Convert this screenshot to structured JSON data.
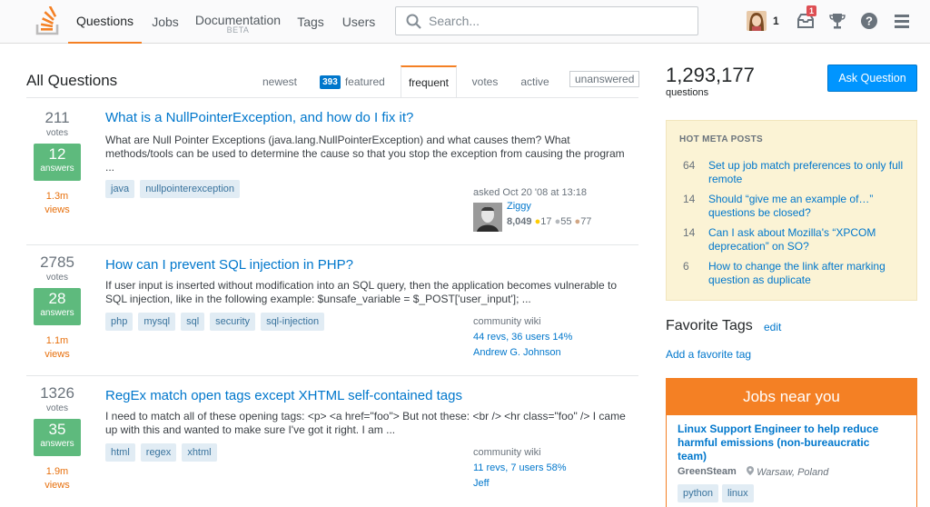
{
  "colors": {
    "accent": "#f48024",
    "link": "#0077cc",
    "accepted": "#5eba7d",
    "views_hot": "#e7700d"
  },
  "nav": {
    "items": [
      {
        "label": "Questions",
        "sub": ""
      },
      {
        "label": "Jobs",
        "sub": ""
      },
      {
        "label": "Documentation",
        "sub": "BETA"
      },
      {
        "label": "Tags",
        "sub": ""
      },
      {
        "label": "Users",
        "sub": ""
      }
    ]
  },
  "search": {
    "placeholder": "Search..."
  },
  "user": {
    "reputation": "1",
    "inbox_count": "1"
  },
  "page": {
    "title": "All Questions"
  },
  "tabs": {
    "newest": "newest",
    "featured_count": "393",
    "featured": "featured",
    "frequent": "frequent",
    "votes": "votes",
    "active": "active",
    "unanswered": "unanswered"
  },
  "questions": [
    {
      "votes": "211",
      "votes_label": "votes",
      "answers": "12",
      "answers_label": "answers",
      "views": "1.3m",
      "views_label": "views",
      "title": "What is a NullPointerException, and how do I fix it?",
      "excerpt": "What are Null Pointer Exceptions (java.lang.NullPointerException) and what causes them? What methods/tools can be used to determine the cause so that you stop the exception from causing the program ...",
      "tags": [
        "java",
        "nullpointerexception"
      ],
      "asked": "asked Oct 20 '08 at 13:18",
      "user": "Ziggy",
      "rep": "8,049",
      "gold": "17",
      "silver": "55",
      "bronze": "77"
    },
    {
      "votes": "2785",
      "votes_label": "votes",
      "answers": "28",
      "answers_label": "answers",
      "views": "1.1m",
      "views_label": "views",
      "title": "How can I prevent SQL injection in PHP?",
      "excerpt": "If user input is inserted without modification into an SQL query, then the application becomes vulnerable to SQL injection, like in the following example: $unsafe_variable = $_POST['user_input']; ...",
      "tags": [
        "php",
        "mysql",
        "sql",
        "security",
        "sql-injection"
      ],
      "wiki": "community wiki",
      "revs": "44 revs, 36 users 14%",
      "user": "Andrew G. Johnson"
    },
    {
      "votes": "1326",
      "votes_label": "votes",
      "answers": "35",
      "answers_label": "answers",
      "views": "1.9m",
      "views_label": "views",
      "title": "RegEx match open tags except XHTML self-contained tags",
      "excerpt": "I need to match all of these opening tags: <p> <a href=\"foo\"> But not these: <br /> <hr class=\"foo\" /> I came up with this and wanted to make sure I've got it right. I am ...",
      "tags": [
        "html",
        "regex",
        "xhtml"
      ],
      "wiki": "community wiki",
      "revs": "11 revs, 7 users 58%",
      "user": "Jeff"
    }
  ],
  "sidebar": {
    "count": "1,293,177",
    "count_label": "questions",
    "ask": "Ask Question",
    "meta_title": "HOT META POSTS",
    "meta": [
      {
        "num": "64",
        "title": "Set up job match preferences to only full remote"
      },
      {
        "num": "14",
        "title": "Should “give me an example of…” questions be closed?"
      },
      {
        "num": "14",
        "title": "Can I ask about Mozilla's “XPCOM deprecation” on SO?"
      },
      {
        "num": "6",
        "title": "How to change the link after marking question as duplicate"
      }
    ],
    "fav_title": "Favorite Tags",
    "fav_edit": "edit",
    "fav_add": "Add a favorite tag",
    "jobs_title": "Jobs near you",
    "job": {
      "title": "Linux Support Engineer to help reduce harmful emissions (non-bureaucratic team)",
      "company": "GreenSteam",
      "location": "Warsaw, Poland",
      "tags": [
        "python",
        "linux"
      ]
    }
  }
}
